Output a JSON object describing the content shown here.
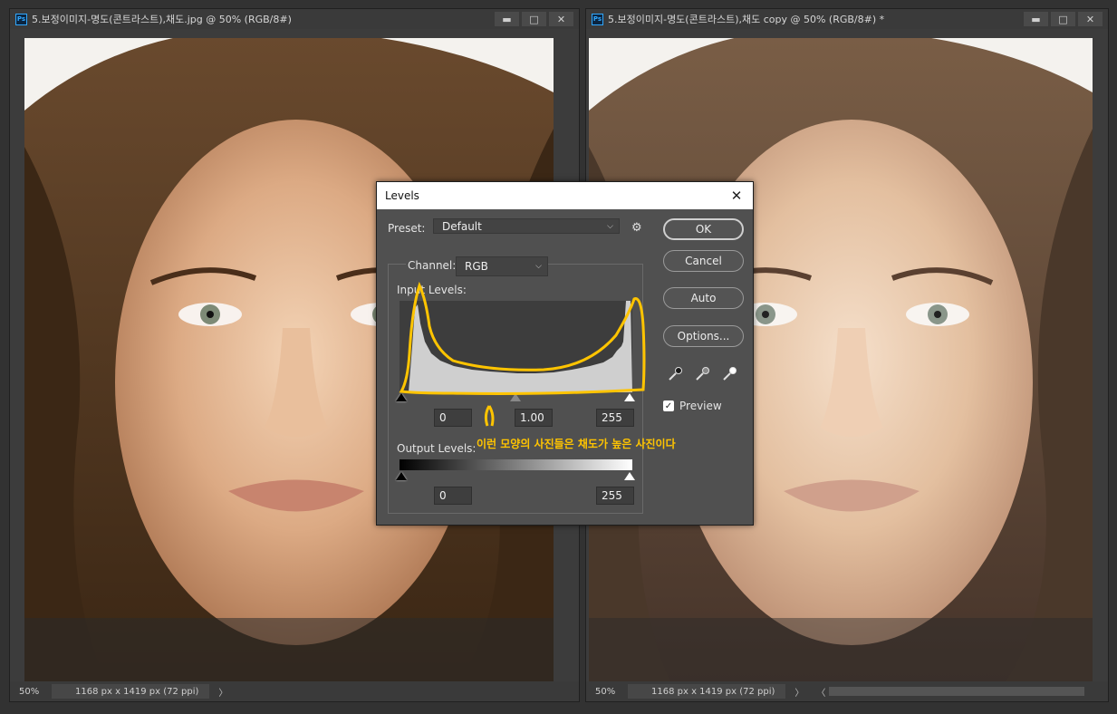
{
  "documents": [
    {
      "title": "5.보정이미지-명도(콘트라스트),채도.jpg @ 50% (RGB/8#)",
      "zoom": "50%",
      "info": "1168 px x 1419 px (72 ppi)",
      "arrow": "〉"
    },
    {
      "title": "5.보정이미지-명도(콘트라스트),채도 copy @ 50% (RGB/8#) *",
      "zoom": "50%",
      "info": "1168 px x 1419 px (72 ppi)",
      "arrow": "〉",
      "arrow_left": "〈"
    }
  ],
  "window_buttons": {
    "minimize": "▬",
    "maximize": "□",
    "close": "✕"
  },
  "levels": {
    "title": "Levels",
    "close": "✕",
    "preset_label": "Preset:",
    "preset_value": "Default",
    "channel_label": "Channel:",
    "channel_value": "RGB",
    "input_levels_label": "Input Levels:",
    "input_black": "0",
    "input_gamma": "1.00",
    "input_white": "255",
    "output_levels_label": "Output Levels:",
    "output_black": "0",
    "output_white": "255",
    "buttons": {
      "ok": "OK",
      "cancel": "Cancel",
      "auto": "Auto",
      "options": "Options..."
    },
    "preview_label": "Preview",
    "preview_checked": true,
    "gear_icon": "⚙"
  },
  "annotation": {
    "text": "이런 모양의 사진들은 채도가 높은 사진이다",
    "color": "#ffc400"
  },
  "colors": {
    "ps_blue": "#31a8ff",
    "dialog_bg": "#505050",
    "annotation": "#ffc400"
  }
}
